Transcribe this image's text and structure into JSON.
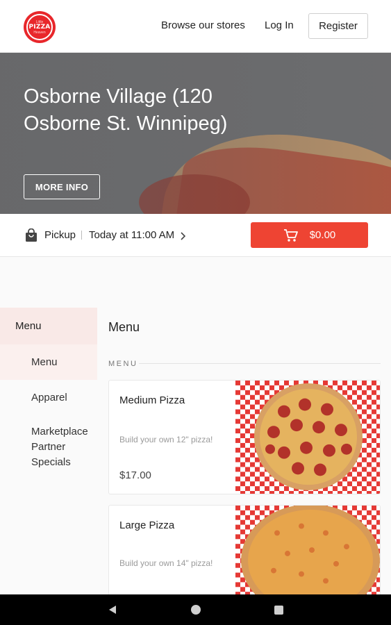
{
  "header": {
    "logo_top": "Little",
    "logo_main": "PIZZA",
    "logo_sub": "Heaven",
    "browse_label": "Browse our stores",
    "login_label": "Log In",
    "register_label": "Register"
  },
  "hero": {
    "store_title": "Osborne Village (120 Osborne St. Winnipeg)",
    "more_info_label": "MORE INFO"
  },
  "order": {
    "mode": "Pickup",
    "time": "Today at 11:00 AM",
    "cart_total": "$0.00"
  },
  "sidebar": {
    "heading": "Menu",
    "items": [
      {
        "label": "Menu"
      },
      {
        "label": "Apparel"
      },
      {
        "label": "Marketplace Partner Specials"
      }
    ]
  },
  "main": {
    "title": "Menu",
    "section_label": "MENU",
    "products": [
      {
        "name": "Medium Pizza",
        "description": "Build your own 12\" pizza!",
        "price": "$17.00",
        "image": "pepperoni-pizza"
      },
      {
        "name": "Large Pizza",
        "description": "Build your own 14\" pizza!",
        "price": "",
        "image": "cheese-pizza"
      }
    ]
  },
  "colors": {
    "accent": "#ee4433",
    "brand_red": "#e8272b"
  },
  "android_nav": {
    "back": "back-icon",
    "home": "home-icon",
    "recent": "recent-apps-icon"
  }
}
